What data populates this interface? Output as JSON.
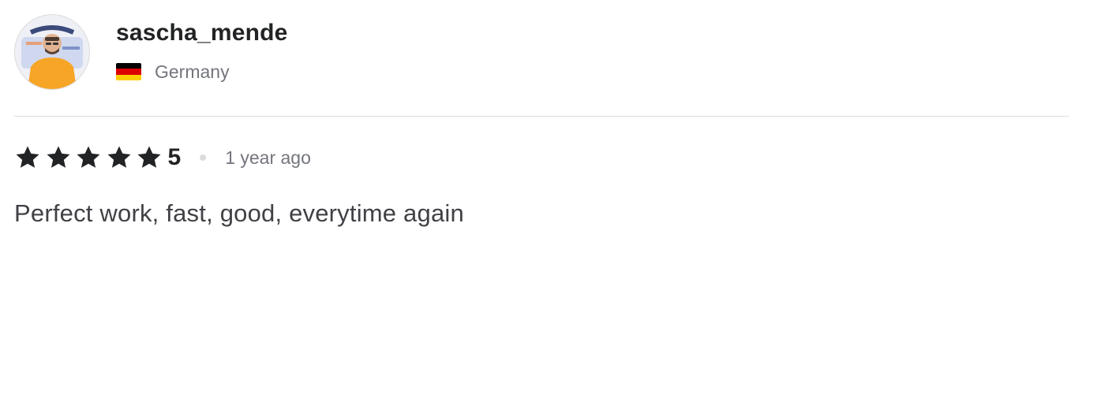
{
  "reviewer": {
    "username": "sascha_mende",
    "country": "Germany",
    "flag_icon": "germany-flag-icon",
    "flag_colors": [
      "#000000",
      "#dd0000",
      "#ffce00"
    ],
    "avatar_icon": "user-avatar-photo"
  },
  "review": {
    "stars": 5,
    "max_stars": 5,
    "rating": "5",
    "time_ago": "1 year ago",
    "text": "Perfect work, fast, good, everytime again"
  },
  "colors": {
    "star": "#222325",
    "username": "#222325",
    "muted": "#74767e",
    "body_text": "#404145",
    "divider": "#dadbdd"
  }
}
